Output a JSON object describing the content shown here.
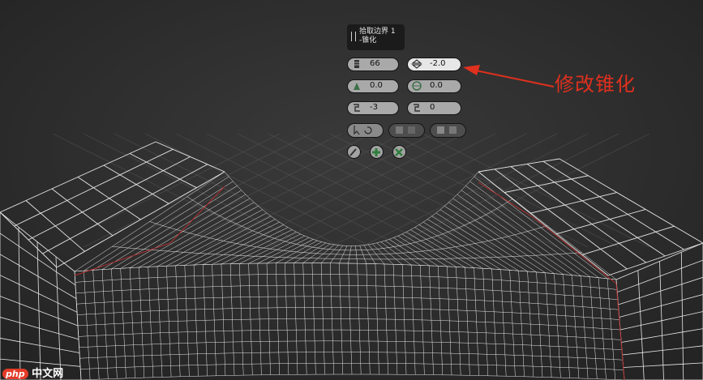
{
  "caddy": {
    "title_line1": "拾取边界 1",
    "title_line2": "-锥化",
    "segments": {
      "value": "66",
      "icon": "segments-icon"
    },
    "taper": {
      "value": "-2.0",
      "icon": "taper-icon"
    },
    "tension": {
      "value": "0.0",
      "icon": "tension-icon"
    },
    "twist": {
      "value": "0.0",
      "icon": "twist-icon"
    },
    "offset_a": {
      "value": "-3",
      "icon": "offset-a-icon"
    },
    "offset_b": {
      "value": "0",
      "icon": "offset-b-icon"
    },
    "buttons": [
      "pick-icon",
      "refresh-icon",
      "edge-loop-icon",
      "edge-ring-icon",
      "ok-icon",
      "apply-icon",
      "cancel-icon"
    ]
  },
  "annotation": {
    "text": "修改锥化",
    "color": "#e0301e"
  },
  "watermark": {
    "brand": "php",
    "text": "中文网"
  },
  "colors": {
    "background": "#2b2b2b",
    "wire": "#e8e8e8",
    "border_line": "#b03030",
    "grid": "#5a5a5a"
  }
}
